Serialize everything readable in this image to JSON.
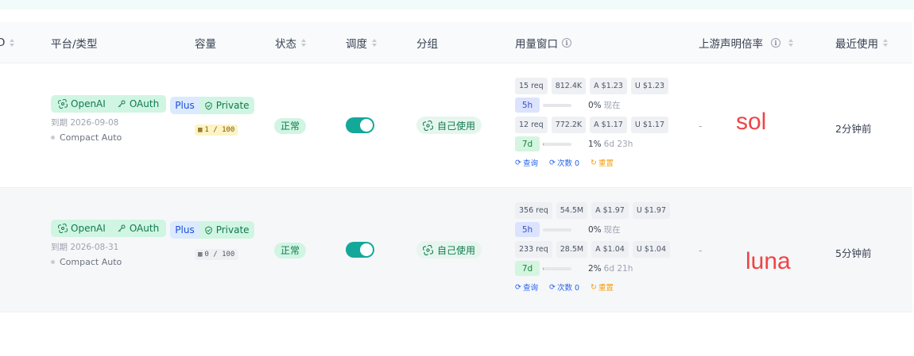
{
  "header": {
    "col0": "D",
    "platform": "平台/类型",
    "capacity": "容量",
    "status": "状态",
    "schedule": "调度",
    "group": "分组",
    "usage_window": "用量窗口",
    "upstream_rate": "上游声明倍率",
    "last_used": "最近使用"
  },
  "rows": [
    {
      "platform": "OpenAI",
      "auth": "OAuth",
      "plan": "Plus",
      "visibility": "Private",
      "expire": "到期 2026-09-08",
      "mode": "Compact Auto",
      "capacity": "1 / 100",
      "capacity_style": "yellow",
      "status": "正常",
      "schedule_on": true,
      "group": "自己使用",
      "usage": {
        "w1_stats": [
          "15 req",
          "812.4K",
          "A $1.23",
          "U $1.23"
        ],
        "w1_label": "5h",
        "w1_pct": "0%",
        "w1_pct_value": 0,
        "w1_when": "现在",
        "w2_stats": [
          "12 req",
          "772.2K",
          "A $1.17",
          "U $1.17"
        ],
        "w2_label": "7d",
        "w2_pct": "1%",
        "w2_pct_value": 1,
        "w2_when": "6d 23h"
      },
      "actions": [
        "查询",
        "次数 0",
        "重置"
      ],
      "upstream_rate": "-",
      "annotation": "sol",
      "last_used": "2分钟前"
    },
    {
      "platform": "OpenAI",
      "auth": "OAuth",
      "plan": "Plus",
      "visibility": "Private",
      "expire": "到期 2026-08-31",
      "mode": "Compact Auto",
      "capacity": "0 / 100",
      "capacity_style": "gray",
      "status": "正常",
      "schedule_on": true,
      "group": "自己使用",
      "usage": {
        "w1_stats": [
          "356 req",
          "54.5M",
          "A $1.97",
          "U $1.97"
        ],
        "w1_label": "5h",
        "w1_pct": "0%",
        "w1_pct_value": 0,
        "w1_when": "现在",
        "w2_stats": [
          "233 req",
          "28.5M",
          "A $1.04",
          "U $1.04"
        ],
        "w2_label": "7d",
        "w2_pct": "2%",
        "w2_pct_value": 2,
        "w2_when": "6d 21h"
      },
      "actions": [
        "查询",
        "次数 0",
        "重置"
      ],
      "upstream_rate": "-",
      "annotation": "luna",
      "last_used": "5分钟前"
    }
  ],
  "colors": {
    "accent": "#14a89a",
    "annotation": "#ef4444",
    "tag_green": "#d1f5e3",
    "tag_blue": "#dbeafe"
  }
}
